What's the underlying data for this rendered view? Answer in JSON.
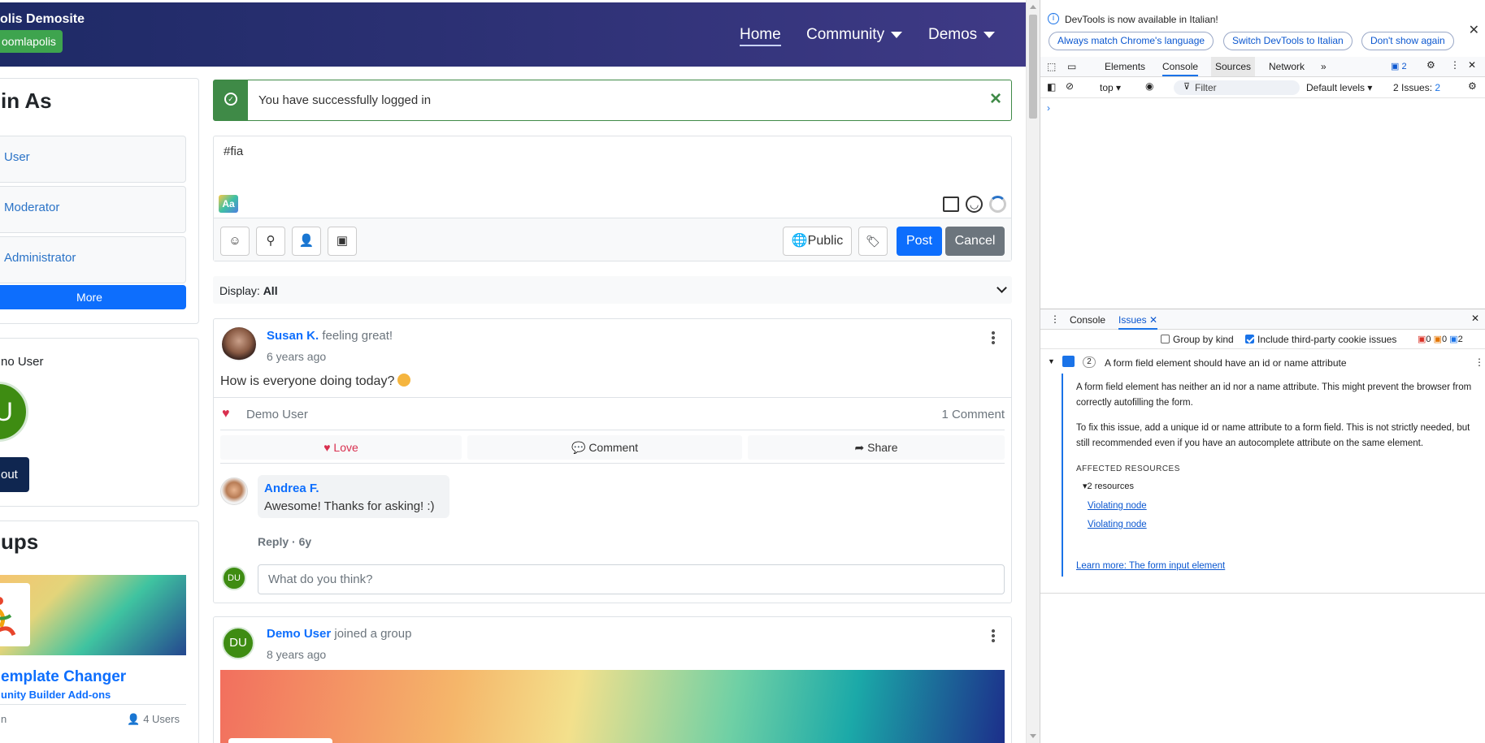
{
  "site": {
    "brand": "olis Demosite",
    "brand_badge": "oomlapolis",
    "nav": {
      "home": "Home",
      "community": "Community",
      "demos": "Demos"
    },
    "login": {
      "title": "in As",
      "buttons": [
        "User",
        "Moderator",
        "Administrator"
      ],
      "more": "More"
    },
    "user": {
      "name": "no User",
      "avatar_initials": "U",
      "logout": "out"
    },
    "groups": {
      "title": "ups",
      "name": "emplate Changer",
      "category": "unity Builder Add-ons",
      "foot_left": "n",
      "users": "4 Users"
    },
    "alert": {
      "text": "You have successfully logged in",
      "close": "×"
    },
    "composer": {
      "value": "#fia",
      "aa": "Aa",
      "public": "Public",
      "post": "Post",
      "cancel": "Cancel"
    },
    "filter": {
      "label": "Display:",
      "value": "All"
    },
    "post1": {
      "author": "Susan K.",
      "activity": "feeling great!",
      "time": "6 years ago",
      "body": "How is everyone doing today?",
      "reaction_user": "Demo User",
      "comment_count": "1 Comment",
      "actions": {
        "love": "Love",
        "comment": "Comment",
        "share": "Share"
      },
      "comment": {
        "author": "Andrea F.",
        "text": "Awesome! Thanks for asking! :)",
        "reply": "Reply",
        "age": "6y"
      },
      "reply_avatar": "DU",
      "reply_placeholder": "What do you think?"
    },
    "post2": {
      "avatar": "DU",
      "author": "Demo User",
      "activity": "joined a group",
      "time": "8 years ago"
    }
  },
  "devtools": {
    "info": "DevTools is now available in Italian!",
    "pills": [
      "Always match Chrome's language",
      "Switch DevTools to Italian",
      "Don't show again"
    ],
    "tabs": [
      "Elements",
      "Console",
      "Sources",
      "Network"
    ],
    "active_tab": "Console",
    "badge_count": "2",
    "context": "top",
    "filter_placeholder": "Filter",
    "levels": "Default levels",
    "issues_label": "2 Issues:",
    "issues_count": "2",
    "drawer_tabs": [
      "Console",
      "Issues"
    ],
    "group_by_kind": "Group by kind",
    "include_third_party": "Include third-party cookie issues",
    "counts": {
      "errors": "0",
      "warnings": "0",
      "info": "2"
    },
    "issue": {
      "count": "2",
      "title": "A form field element should have an id or name attribute",
      "p1": "A form field element has neither an id nor a name attribute. This might prevent the browser from correctly autofilling the form.",
      "p2": "To fix this issue, add a unique id or name attribute to a form field. This is not strictly needed, but still recommended even if you have an autocomplete attribute on the same element.",
      "affected": "AFFECTED RESOURCES",
      "resources": "2 resources",
      "nodes": [
        "Violating node",
        "Violating node"
      ],
      "learn_more": "Learn more: The form input element"
    },
    "colors": {
      "accent": "#1a73e8",
      "error": "#d93025"
    }
  }
}
